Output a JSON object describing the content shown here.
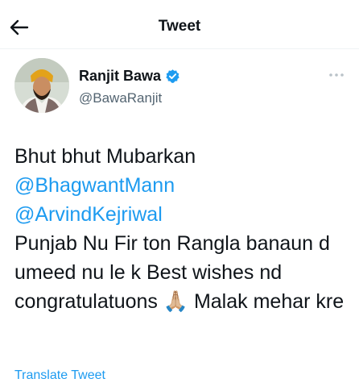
{
  "header": {
    "title": "Tweet",
    "back_icon": "arrow-left-icon"
  },
  "author": {
    "name": "Ranjit Bawa",
    "handle": "@BawaRanjit",
    "verified_icon": "verified-badge-icon",
    "more_icon": "more-horizontal-icon"
  },
  "tweet": {
    "line1": "Bhut bhut Mubarkan",
    "mention1": "@BhagwantMann",
    "mention2": "@ArvindKejriwal",
    "body": "Punjab Nu Fir ton Rangla banaun d umeed nu le k  Best wishes nd congratulatuons",
    "emoji": "🙏🏼",
    "closing": "Malak mehar kre"
  },
  "translate_label": "Translate Tweet",
  "colors": {
    "accent": "#1d9bf0",
    "text": "#0f1419",
    "muted": "#536471"
  }
}
